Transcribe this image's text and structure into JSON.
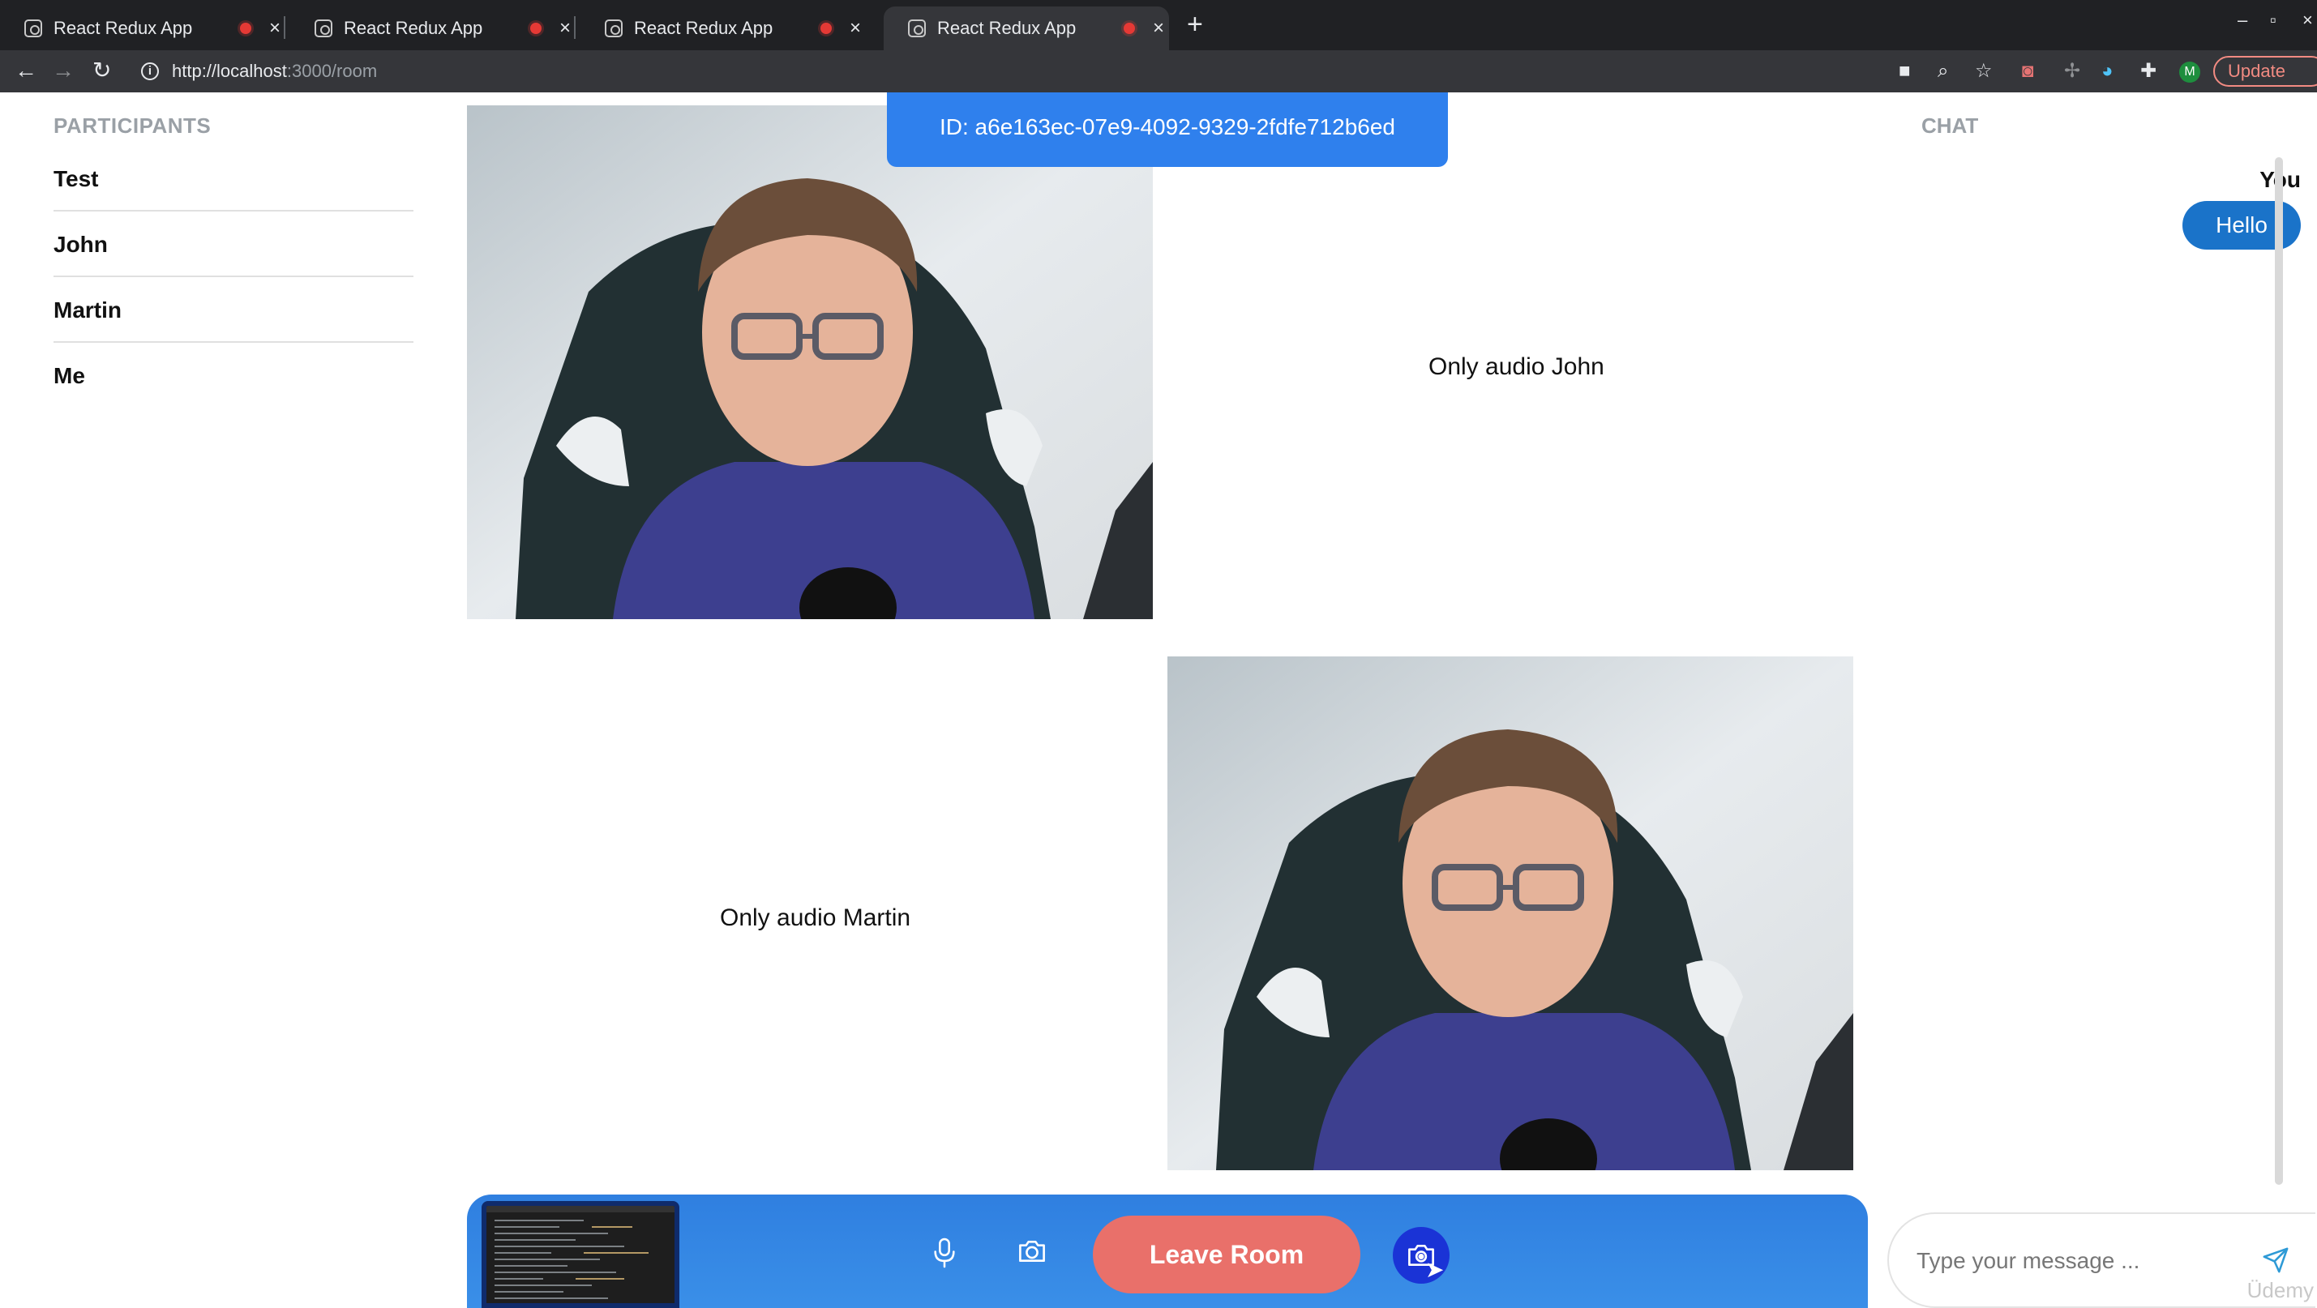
{
  "browser": {
    "tabs": [
      {
        "title": "React Redux App"
      },
      {
        "title": "React Redux App"
      },
      {
        "title": "React Redux App"
      },
      {
        "title": "React Redux App"
      }
    ],
    "url_host": "http://localhost",
    "url_path": ":3000/room",
    "profile_initial": "M",
    "update_label": "Update"
  },
  "room": {
    "id_text": "ID: a6e163ec-07e9-4092-9329-2fdfe712b6ed"
  },
  "participants": {
    "title": "PARTICIPANTS",
    "items": [
      "Test",
      "John",
      "Martin",
      "Me"
    ]
  },
  "videos": {
    "audio_only_john": "Only audio John",
    "audio_only_martin": "Only audio Martin"
  },
  "chat": {
    "title": "CHAT",
    "messages": [
      {
        "author": "You",
        "text": "Hello"
      }
    ],
    "input_placeholder": "Type your message ..."
  },
  "controls": {
    "leave_label": "Leave Room"
  },
  "watermark": "Üdemy",
  "colors": {
    "accent": "#2f80ed",
    "leave": "#e9706a",
    "share": "#1a33d6",
    "bubble": "#1a73c9"
  }
}
